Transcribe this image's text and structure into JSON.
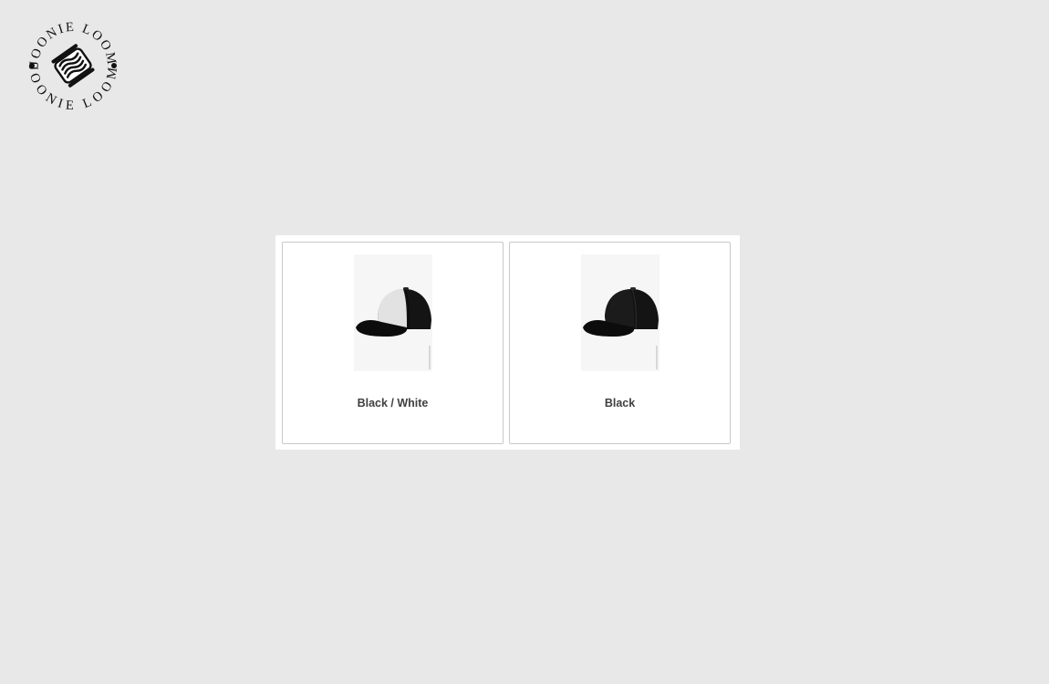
{
  "brand": {
    "logo_text_top": "JOONIE LOOM",
    "logo_text_bottom": "JOONIE LOOM",
    "icon": "yarn-spool-icon"
  },
  "variants": [
    {
      "label": "Black / White",
      "icon": "trucker-cap-black-white-icon",
      "colors": {
        "front": "#e2e2e2",
        "back": "#141414",
        "brim": "#0c0c0c"
      }
    },
    {
      "label": "Black",
      "icon": "snapback-cap-black-icon",
      "colors": {
        "front": "#1b1b1b",
        "back": "#141414",
        "brim": "#0c0c0c"
      }
    }
  ]
}
